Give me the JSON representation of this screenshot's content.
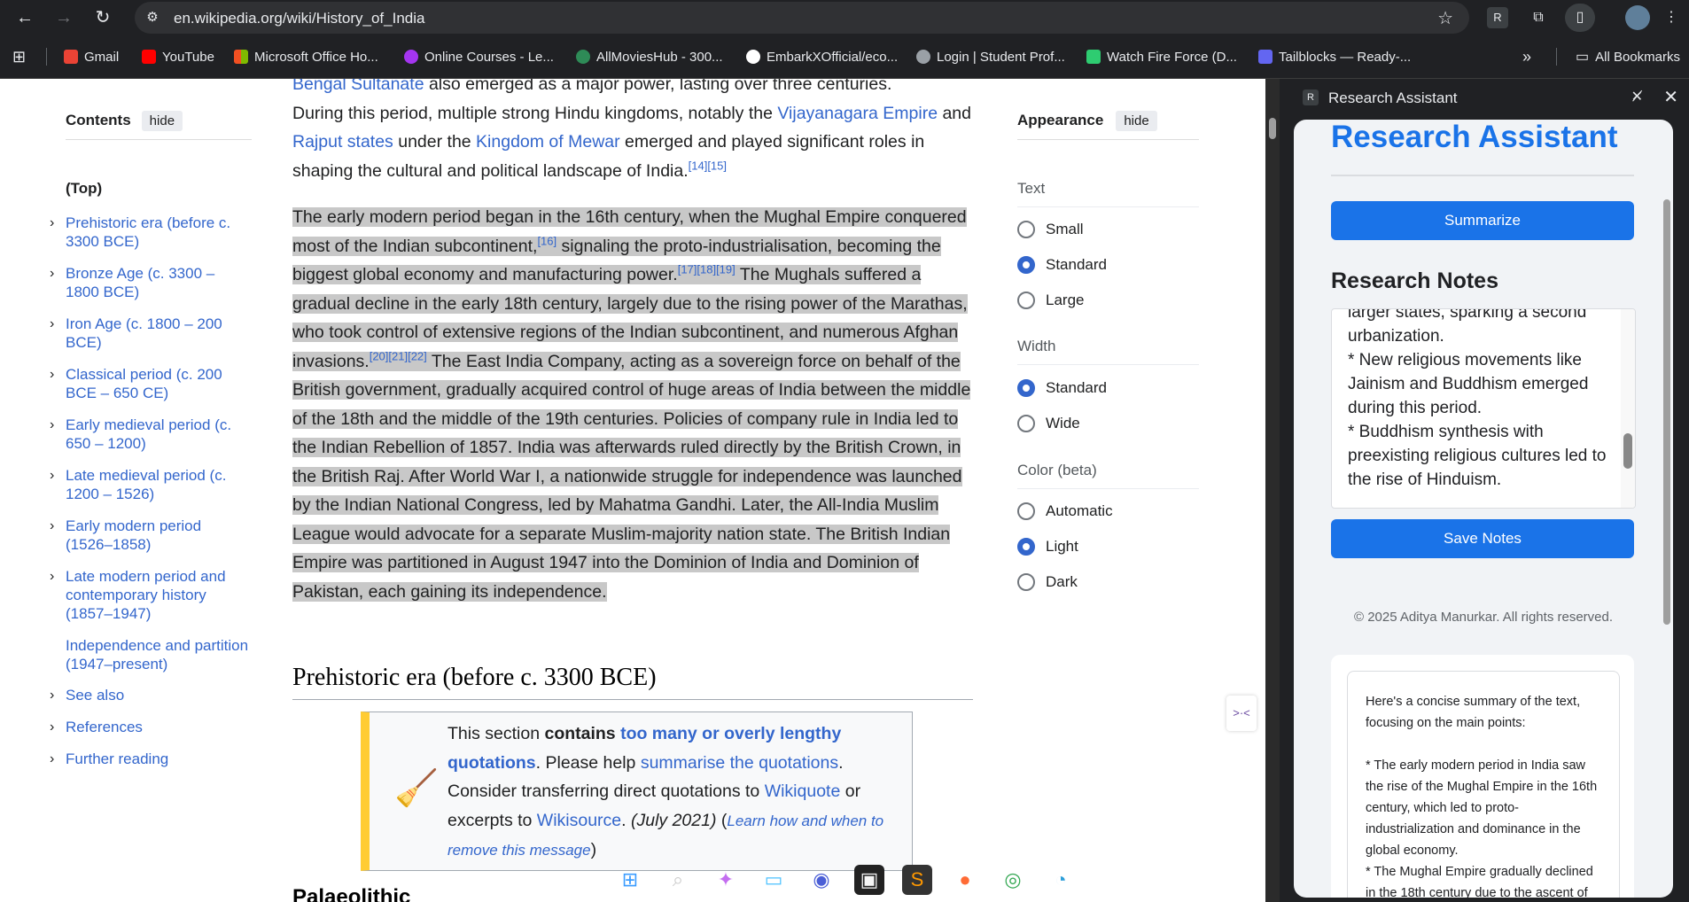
{
  "browser": {
    "url": "en.wikipedia.org/wiki/History_of_India",
    "profile_initial": "R"
  },
  "bookmarks": [
    {
      "label": "Gmail",
      "color": "#ea4335"
    },
    {
      "label": "YouTube",
      "color": "#ff0000"
    },
    {
      "label": "Microsoft Office Ho...",
      "color": "#f25022"
    },
    {
      "label": "Online Courses - Le...",
      "color": "#a435f0"
    },
    {
      "label": "AllMoviesHub - 300...",
      "color": "#2e8b57"
    },
    {
      "label": "EmbarkXOfficial/eco...",
      "color": "#ffffff"
    },
    {
      "label": "Login | Student Prof...",
      "color": "#9aa0a6"
    },
    {
      "label": "Watch Fire Force (D...",
      "color": "#2ecc71"
    },
    {
      "label": "Tailblocks — Ready-...",
      "color": "#6366f1"
    }
  ],
  "bookmarks_overflow": "»",
  "all_bookmarks": "All Bookmarks",
  "toc": {
    "title": "Contents",
    "hide": "hide",
    "top": "(Top)",
    "items": [
      "Prehistoric era (before c. 3300 BCE)",
      "Bronze Age (c. 3300 – 1800 BCE)",
      "Iron Age (c. 1800 – 200 BCE)",
      "Classical period (c. 200 BCE – 650 CE)",
      "Early medieval period (c. 650 – 1200)",
      "Late medieval period (c. 1200 – 1526)",
      "Early modern period (1526–1858)",
      "Late modern period and contemporary history (1857–1947)",
      "Independence and partition (1947–present)",
      "See also",
      "References",
      "Further reading"
    ]
  },
  "article": {
    "p0_link": "Bengal Sultanate",
    "p0_rest": " also emerged as a major power, lasting over three centuries.",
    "p1_a": "During this period, multiple strong Hindu kingdoms, notably the ",
    "p1_link1": "Vijayanagara Empire",
    "p1_b": " and ",
    "p1_link2": "Rajput states",
    "p1_c": " under the ",
    "p1_link3": "Kingdom of Mewar",
    "p1_d": " emerged and played significant roles in shaping the cultural and political landscape of India.",
    "p1_ref": "[14][15]",
    "p2_a": "The early modern period began in the 16th century, when the Mughal Empire conquered most of the Indian subcontinent,",
    "p2_ref1": "[16]",
    "p2_b": " signaling the proto-industrialisation, becoming the biggest global economy and manufacturing power.",
    "p2_ref2": "[17][18][19]",
    "p2_c": " The Mughals suffered a gradual decline in the early 18th century, largely due to the rising power of the Marathas, who took control of extensive regions of the Indian subcontinent, and numerous Afghan invasions.",
    "p2_ref3": "[20][21][22]",
    "p2_d": " The East India Company, acting as a sovereign force on behalf of the British government, gradually acquired control of huge areas of India between the middle of the 18th and the middle of the 19th centuries. Policies of company rule in India led to the Indian Rebellion of 1857. India was afterwards ruled directly by the British Crown, in the British Raj. After World War I, a nationwide struggle for independence was launched by the Indian National Congress, led by Mahatma Gandhi. Later, the All-India Muslim League would advocate for a separate Muslim-majority nation state. The British Indian Empire was partitioned in August 1947 into the Dominion of India and Dominion of Pakistan, each gaining its independence.",
    "h2": "Prehistoric era (before c. 3300 BCE)",
    "ambox_a": "This section ",
    "ambox_b": "contains",
    "ambox_link1": "too many or overly lengthy quotations",
    "ambox_c": ". Please help ",
    "ambox_link2": "summarise the quotations",
    "ambox_d": ". Consider transferring direct quotations to ",
    "ambox_link3": "Wikiquote",
    "ambox_e": " or excerpts to ",
    "ambox_link4": "Wikisource",
    "ambox_f": ". ",
    "ambox_date": "(July 2021)",
    "ambox_g": " (",
    "ambox_link5": "Learn how and when to remove this message",
    "ambox_h": ")",
    "h3": "Palaeolithic"
  },
  "appearance": {
    "title": "Appearance",
    "hide": "hide",
    "text_label": "Text",
    "text_options": [
      "Small",
      "Standard",
      "Large"
    ],
    "text_selected": "Standard",
    "width_label": "Width",
    "width_options": [
      "Standard",
      "Wide"
    ],
    "width_selected": "Standard",
    "color_label": "Color (beta)",
    "color_options": [
      "Automatic",
      "Light",
      "Dark"
    ],
    "color_selected": "Light"
  },
  "side_panel": {
    "header_title": "Research Assistant",
    "header_icon": "R",
    "app_title": "Research Assistant",
    "summarize_btn": "Summarize",
    "notes_heading": "Research Notes",
    "notes_text": "larger states, sparking a second urbanization.\n* New religious movements like Jainism and Buddhism emerged during this period.\n* Buddhism synthesis with preexisting religious cultures led to the rise of Hinduism.",
    "save_btn": "Save Notes",
    "copyright": "© 2025 Aditya Manurkar. All rights reserved.",
    "summary_text": "Here's a concise summary of the text, focusing on the main points:\n\n* The early modern period in India saw the rise of the Mughal Empire in the 16th century, which led to proto-industrialization and dominance in the global economy.\n* The Mughal Empire gradually declined in the 18th century due to the ascent of"
  },
  "colors": {
    "accent": "#1a73e8",
    "wiki_link": "#3366cc",
    "selection": "#c8c8c8"
  }
}
